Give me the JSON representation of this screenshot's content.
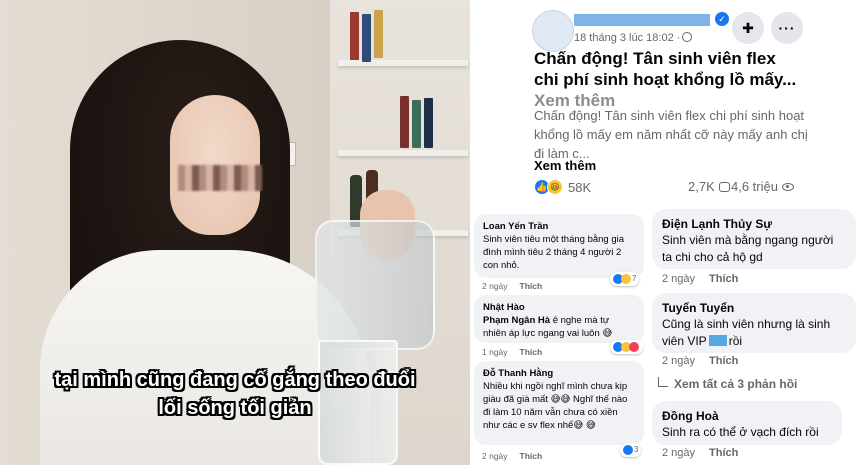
{
  "photo": {
    "caption_line1": "tại mình cũng đang cố gắng theo đuổi",
    "caption_line2": "lối sống tối giản"
  },
  "post": {
    "timestamp": "18 tháng 3 lúc 18:02 ·",
    "headline": "Chấn động! Tân sinh viên flex chi phí sinh hoạt khổng lồ mấy...",
    "headline_more": "Xem thêm",
    "body": "Chấn động! Tân sinh viên flex chi phí sinh hoạt khổng lồ mấy em năm nhất cỡ này mấy anh chị đi làm c...",
    "see_more": "Xem thêm",
    "reaction_count": "58K",
    "comment_count": "2,7K",
    "view_count": "4,6 triệu"
  },
  "comments_left": [
    {
      "name": "Loan Yến Trần",
      "text": "Sinh viên tiêu một tháng bằng gia đình mình tiêu 2 tháng 4 người 2 con nhỏ.",
      "time": "2 ngày",
      "like": "Thích",
      "reacts": "7"
    },
    {
      "name": "Nhật Hào",
      "tag": "Phạm Ngân Hà",
      "text": "ê nghe mà tự nhiên áp lực ngang vai luôn 😅",
      "time": "1 ngày",
      "like": "Thích",
      "reacts": ""
    },
    {
      "name": "Đỗ Thanh Hằng",
      "text": "Nhiều khi ngồi nghĩ mình chưa kịp giàu đã già mất 😅😅 Nghĩ thế nào đi làm 10 năm vẫn chưa có xiền như các e sv flex nhể😅 😅",
      "time": "2 ngày",
      "like": "Thích",
      "reacts": "3"
    }
  ],
  "comments_right": [
    {
      "name": "Điện Lạnh Thủy Sự",
      "text": "Sinh viên mà bằng ngang người ta chi cho cả hộ gd",
      "time": "2 ngày",
      "like": "Thích"
    },
    {
      "name": "Tuyển Tuyển",
      "text_a": "Cũng là sinh viên nhưng là sinh viên VIP",
      "text_b": "rồi",
      "time": "2 ngày",
      "like": "Thích"
    },
    {
      "view_replies": "Xem tất cả 3 phản hồi"
    },
    {
      "name": "Đồng Hoà",
      "text": "Sinh ra có thể ở vạch đích rồi",
      "time": "2 ngày",
      "like": "Thích"
    }
  ],
  "colors": {
    "accent": "#1877f2",
    "bubble": "#f0f2f5",
    "muted": "#65676b"
  }
}
